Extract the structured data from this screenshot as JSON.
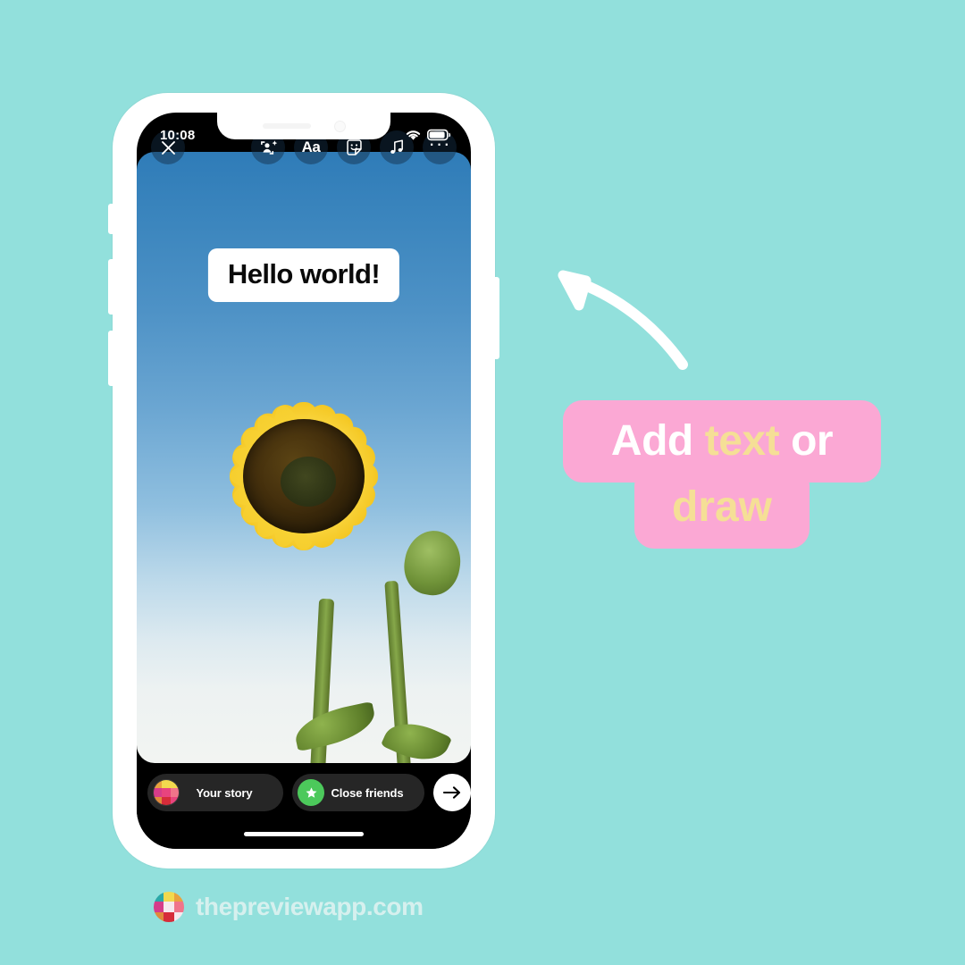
{
  "background_color": "#92E0DC",
  "phone": {
    "status_bar": {
      "time": "10:08",
      "wifi_icon": "wifi-icon",
      "battery_icon": "battery-icon"
    },
    "story_editor": {
      "close_button": {
        "name": "close-icon",
        "glyph": "✕"
      },
      "tools": [
        {
          "name": "effects-icon",
          "label": "Effects"
        },
        {
          "name": "text-tool-icon",
          "label": "Aa"
        },
        {
          "name": "sticker-icon",
          "label": "Stickers"
        },
        {
          "name": "music-icon",
          "label": "Music"
        },
        {
          "name": "more-options-icon",
          "label": "···"
        }
      ],
      "text_sticker": {
        "value": "Hello world!",
        "text_color": "#0A0A0A",
        "bg_color": "#FFFFFF"
      },
      "photo": {
        "subject": "sunflower-photo",
        "sky_color": "#4E92C6",
        "petal_color": "#FBD93E",
        "disc_color": "#2C1F08"
      }
    },
    "share_bar": {
      "your_story": {
        "label": "Your story",
        "avatar": "preview-grid-avatar"
      },
      "close_friends": {
        "label": "Close friends",
        "badge": "green-star-icon",
        "badge_color": "#4CC95B"
      },
      "send_button": {
        "name": "send-arrow-icon",
        "glyph": "→"
      }
    }
  },
  "annotation": {
    "arrow": "curved-arrow-icon",
    "arrow_color": "#FFFFFF",
    "callout": {
      "line1": [
        {
          "text": "Add",
          "color": "#FFFFFF"
        },
        {
          "text": "text",
          "color": "#F5DF96"
        },
        {
          "text": "or",
          "color": "#FFFFFF"
        }
      ],
      "line2": [
        {
          "text": "draw",
          "color": "#F5DF96"
        }
      ],
      "bg_color": "#FBA8D4"
    }
  },
  "watermark": {
    "text": "thepreviewapp.com",
    "text_color": "#D6F0EE",
    "logo": "preview-app-logo"
  }
}
